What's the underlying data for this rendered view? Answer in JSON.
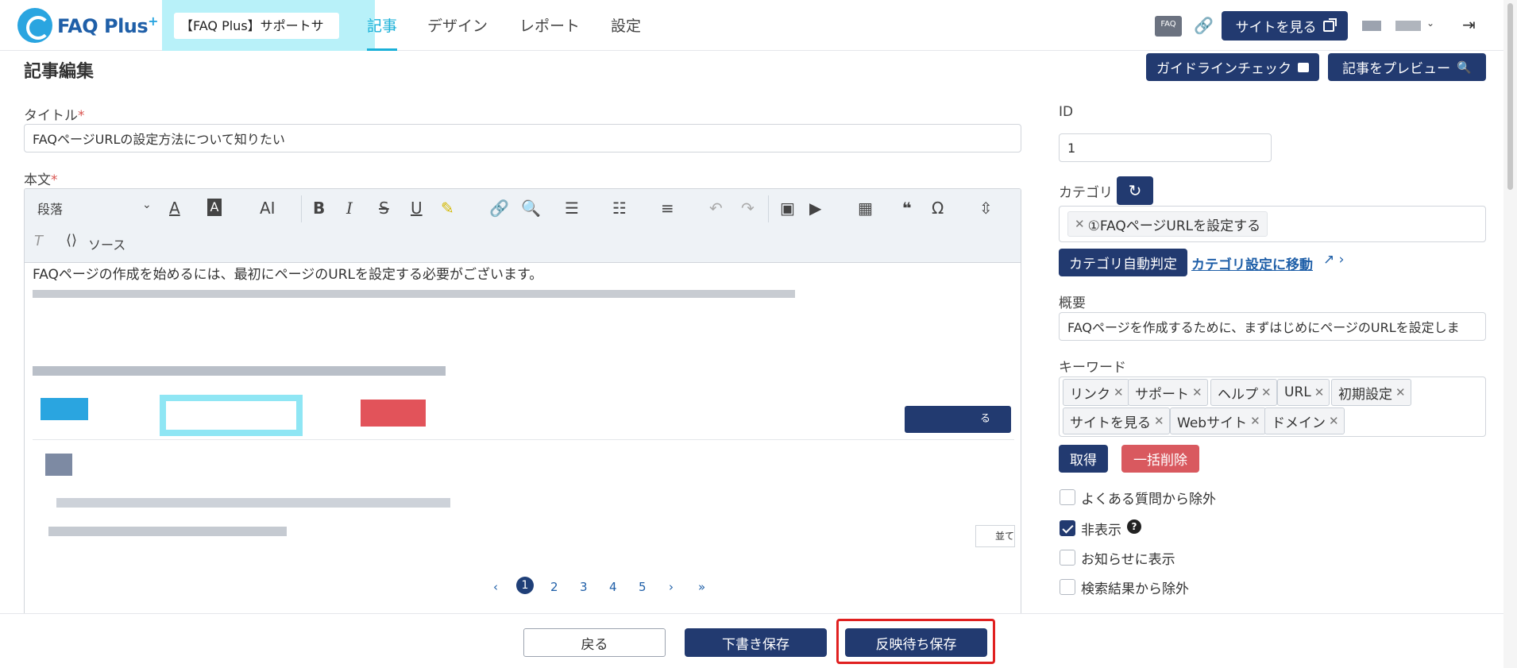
{
  "header": {
    "logo_text": "FAQ Plus",
    "logo_plus": "+",
    "site_name": "【FAQ Plus】サポートサ",
    "tabs": [
      {
        "label": "記事",
        "active": true
      },
      {
        "label": "デザイン",
        "active": false
      },
      {
        "label": "レポート",
        "active": false
      },
      {
        "label": "設定",
        "active": false
      }
    ],
    "faq_badge": "FAQ",
    "view_site_label": "サイトを見る"
  },
  "page": {
    "title": "記事編集",
    "guideline_check_label": "ガイドラインチェック",
    "preview_label": "記事をプレビュー"
  },
  "form": {
    "title_label": "タイトル",
    "title_value": "FAQページURLの設定方法について知りたい",
    "body_label": "本文",
    "required_mark": "*"
  },
  "toolbar": {
    "paragraph_select": "段落",
    "source_label": "ソース"
  },
  "editor": {
    "first_line": "FAQページの作成を始めるには、最初にページのURLを設定する必要がございます。",
    "inner_button_suffix": "る",
    "inner_sort_label": "並て",
    "pagination": [
      "‹",
      "1",
      "2",
      "3",
      "4",
      "5",
      "›",
      "»"
    ],
    "active_page": "1"
  },
  "sidebar": {
    "id_label": "ID",
    "id_value": "1",
    "category_label": "カテゴリ",
    "category_tag": "①FAQページURLを設定する",
    "category_auto_label": "カテゴリ自動判定",
    "category_settings_link": "カテゴリ設定に移動",
    "summary_label": "概要",
    "summary_value": "FAQページを作成するために、まずはじめにページのURLを設定しま",
    "keyword_label": "キーワード",
    "keywords": [
      "リンク",
      "サポート",
      "ヘルプ",
      "URL",
      "初期設定",
      "サイトを見る",
      "Webサイト",
      "ドメイン"
    ],
    "fetch_label": "取得",
    "bulk_delete_label": "一括削除",
    "checkboxes": [
      {
        "label": "よくある質問から除外",
        "checked": false
      },
      {
        "label": "非表示",
        "checked": true
      },
      {
        "label": "お知らせに表示",
        "checked": false
      },
      {
        "label": "検索結果から除外",
        "checked": false
      }
    ]
  },
  "footer": {
    "back_label": "戻る",
    "draft_save_label": "下書き保存",
    "pending_save_label": "反映待ち保存"
  },
  "colors": {
    "navy": "#223a70",
    "accent": "#1ab0d8",
    "danger": "#d9595f",
    "highlight": "#e02020"
  }
}
